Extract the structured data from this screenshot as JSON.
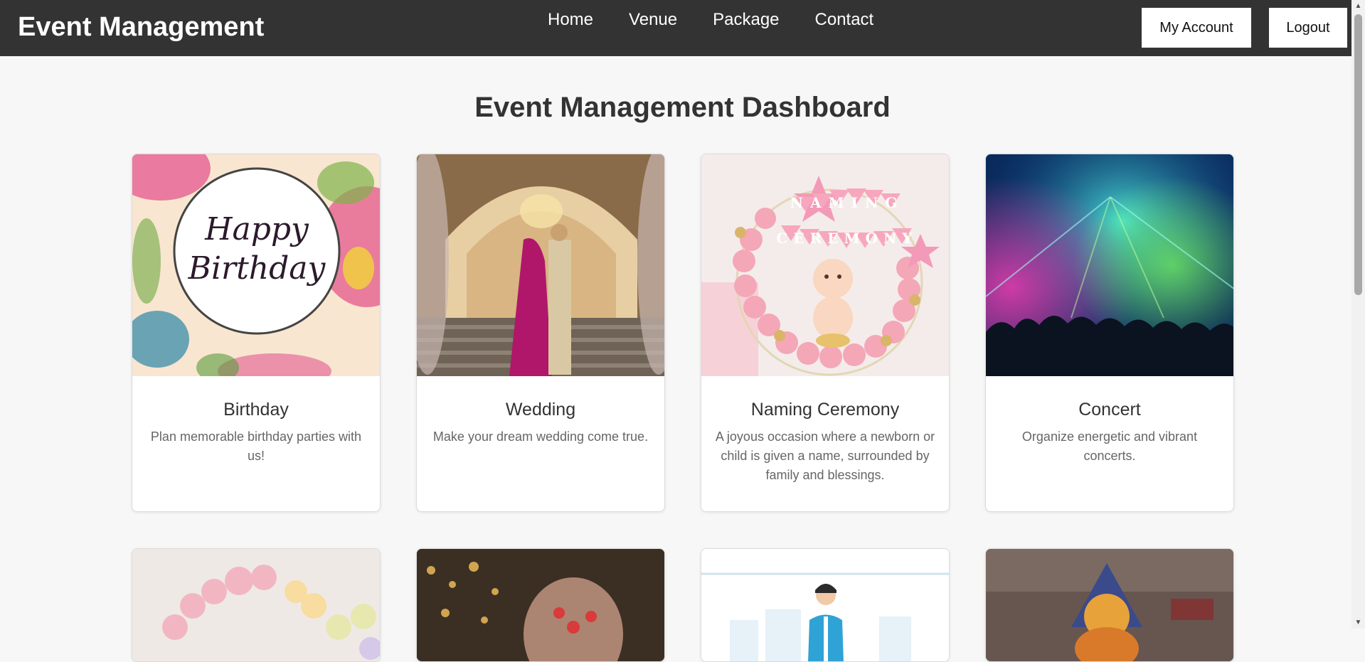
{
  "header": {
    "brand": "Event Management",
    "nav": [
      "Home",
      "Venue",
      "Package",
      "Contact"
    ],
    "my_account": "My Account",
    "logout": "Logout"
  },
  "main": {
    "title": "Event Management Dashboard",
    "cards": [
      {
        "title": "Birthday",
        "description": "Plan memorable birthday parties with us!",
        "image_text_1": "Happy",
        "image_text_2": "Birthday"
      },
      {
        "title": "Wedding",
        "description": "Make your dream wedding come true."
      },
      {
        "title": "Naming Ceremony",
        "description": "A joyous occasion where a newborn or child is given a name, surrounded by family and blessings.",
        "image_banner_1": "NAMING",
        "image_banner_2": "CEREMONY"
      },
      {
        "title": "Concert",
        "description": "Organize energetic and vibrant concerts."
      }
    ]
  },
  "colors": {
    "header_bg": "#333333",
    "page_bg": "#f7f7f7",
    "card_bg": "#ffffff",
    "title_text": "#333333",
    "desc_text": "#666666"
  },
  "icons": {
    "scroll_up": "scroll-up-arrow-icon",
    "scroll_down": "scroll-down-arrow-icon"
  }
}
